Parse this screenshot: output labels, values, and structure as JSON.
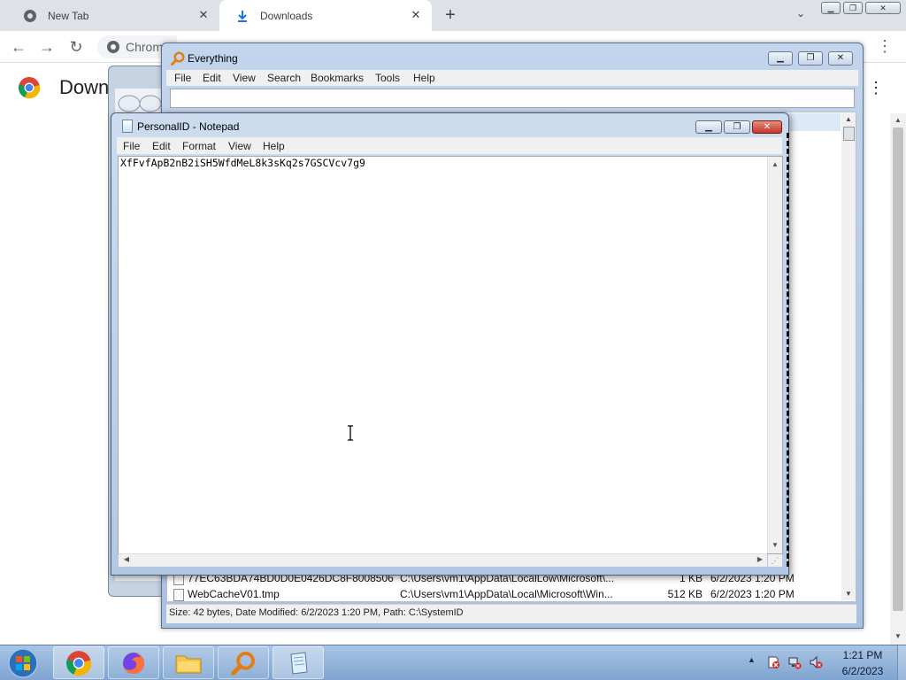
{
  "chrome": {
    "tabs": [
      {
        "label": "New Tab"
      },
      {
        "label": "Downloads"
      }
    ],
    "omnibox_text": "Chrom",
    "page_title": "Down"
  },
  "everything": {
    "title": "Everything",
    "menu": [
      "File",
      "Edit",
      "View",
      "Search",
      "Bookmarks",
      "Tools",
      "Help"
    ],
    "search_value": "",
    "rows": [
      {
        "name": "77EC63BDA74BD0D0E0426DC8F8008506",
        "path": "C:\\Users\\vm1\\AppData\\LocalLow\\Microsoft\\...",
        "size": "1 KB",
        "date": "6/2/2023 1:20 PM"
      },
      {
        "name": "WebCacheV01.tmp",
        "path": "C:\\Users\\vm1\\AppData\\Local\\Microsoft\\Win...",
        "size": "512 KB",
        "date": "6/2/2023 1:20 PM"
      }
    ],
    "status": "Size: 42 bytes, Date Modified: 6/2/2023 1:20 PM, Path: C:\\SystemID"
  },
  "notepad": {
    "title": "PersonalID - Notepad",
    "menu": [
      "File",
      "Edit",
      "Format",
      "View",
      "Help"
    ],
    "content": "XfFvfApB2nB2iSH5WfdMeL8k3sKq2s7GSCVcv7g9"
  },
  "taskbar": {
    "time": "1:21 PM",
    "date": "6/2/2023"
  },
  "colors": {
    "chrome_tabstrip": "#dee1e6",
    "taskbar": "#7fa4d1",
    "notepad_close": "#c2382a"
  }
}
